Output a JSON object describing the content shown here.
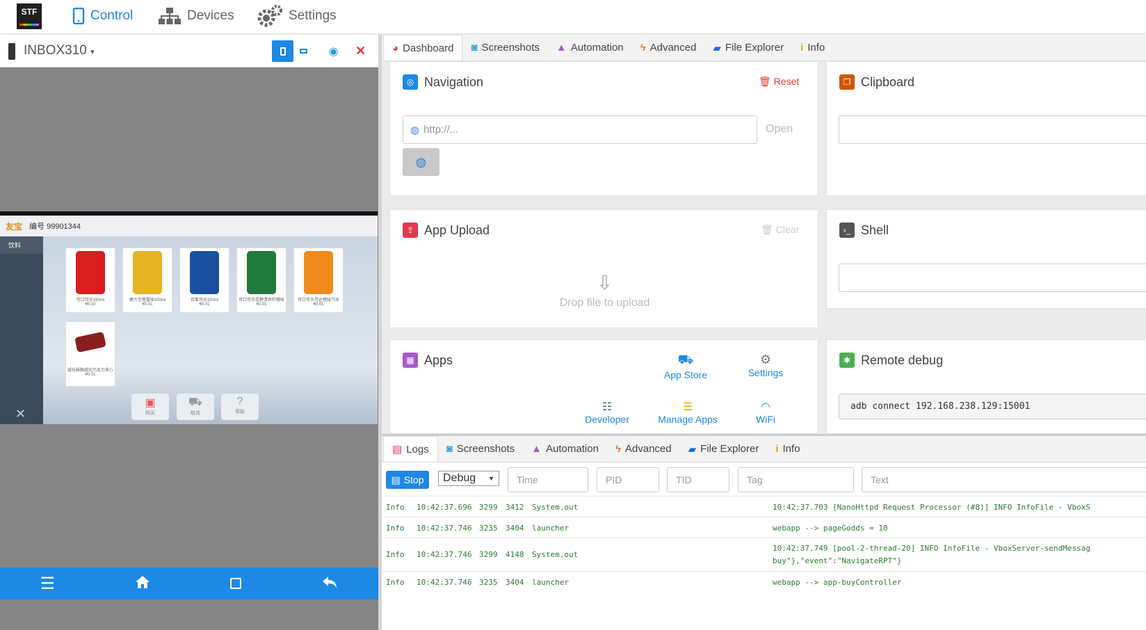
{
  "topnav": {
    "logo": "STF",
    "items": [
      {
        "label": "Control",
        "icon": "phone-icon",
        "active": true
      },
      {
        "label": "Devices",
        "icon": "sitemap-icon",
        "active": false
      },
      {
        "label": "Settings",
        "icon": "gears-icon",
        "active": false
      }
    ]
  },
  "device": {
    "name": "INBOX310",
    "screen": {
      "brand": "友宝",
      "serial": "编号 99901344",
      "category": "饮料",
      "products": [
        {
          "name": "可口可乐330ml",
          "price": "¥0.10",
          "color": "#d81e1e"
        },
        {
          "name": "健力宝橙蜜味330ml",
          "price": "¥0.01",
          "color": "#e8b323"
        },
        {
          "name": "百事可乐330ml",
          "price": "¥0.01",
          "color": "#1a4fa0"
        },
        {
          "name": "可口可乐雪碧清爽柠檬味",
          "price": "¥0.01",
          "color": "#1f7a3b"
        },
        {
          "name": "可口可乐芬达橙味汽水",
          "price": "¥0.01",
          "color": "#f08a1c"
        },
        {
          "name": "威化酥脆威化巧克力夹心",
          "price": "¥0.01",
          "color": "#8a1e1e"
        }
      ],
      "buttons": [
        "购买",
        "取货",
        "帮助"
      ]
    }
  },
  "tabs": [
    "Dashboard",
    "Screenshots",
    "Automation",
    "Advanced",
    "File Explorer",
    "Info"
  ],
  "navigation": {
    "title": "Navigation",
    "reset": "Reset",
    "url_placeholder": "http://...",
    "open": "Open"
  },
  "clipboard": {
    "title": "Clipboard"
  },
  "app_upload": {
    "title": "App Upload",
    "clear": "Clear",
    "drop": "Drop file to upload"
  },
  "shell": {
    "title": "Shell"
  },
  "apps": {
    "title": "Apps",
    "items": [
      "App Store",
      "Settings",
      "Developer",
      "Manage Apps",
      "WiFi"
    ]
  },
  "remote_debug": {
    "title": "Remote debug",
    "command": "adb connect 192.168.238.129:15001"
  },
  "log_tabs": [
    "Logs",
    "Screenshots",
    "Automation",
    "Advanced",
    "File Explorer",
    "Info"
  ],
  "log_filters": {
    "stop": "Stop",
    "level": "Debug",
    "time": "Time",
    "pid": "PID",
    "tid": "TID",
    "tag": "Tag",
    "text": "Text"
  },
  "logs": [
    {
      "level": "Info",
      "time": "10:42:37.696",
      "pid": "3299",
      "tid": "3412",
      "tag": "System.out",
      "msg1": "10:42:37.703 [NanoHttpd Request Processor (#8)] INFO  InfoFile - VboxS",
      "msg2": ""
    },
    {
      "level": "Info",
      "time": "10:42:37.746",
      "pid": "3235",
      "tid": "3404",
      "tag": "launcher",
      "msg1": "webapp   --> pageGodds = 10",
      "msg2": ""
    },
    {
      "level": "Info",
      "time": "10:42:37.746",
      "pid": "3299",
      "tid": "4148",
      "tag": "System.out",
      "msg1": "10:42:37.749 [pool-2-thread-20] INFO  InfoFile - VboxServer-sendMessag",
      "msg2": "buy\"},\"event\":\"NavigateRPT\"}"
    },
    {
      "level": "Info",
      "time": "10:42:37.746",
      "pid": "3235",
      "tid": "3404",
      "tag": "launcher",
      "msg1": "webapp   --> app-buyController",
      "msg2": ""
    }
  ]
}
